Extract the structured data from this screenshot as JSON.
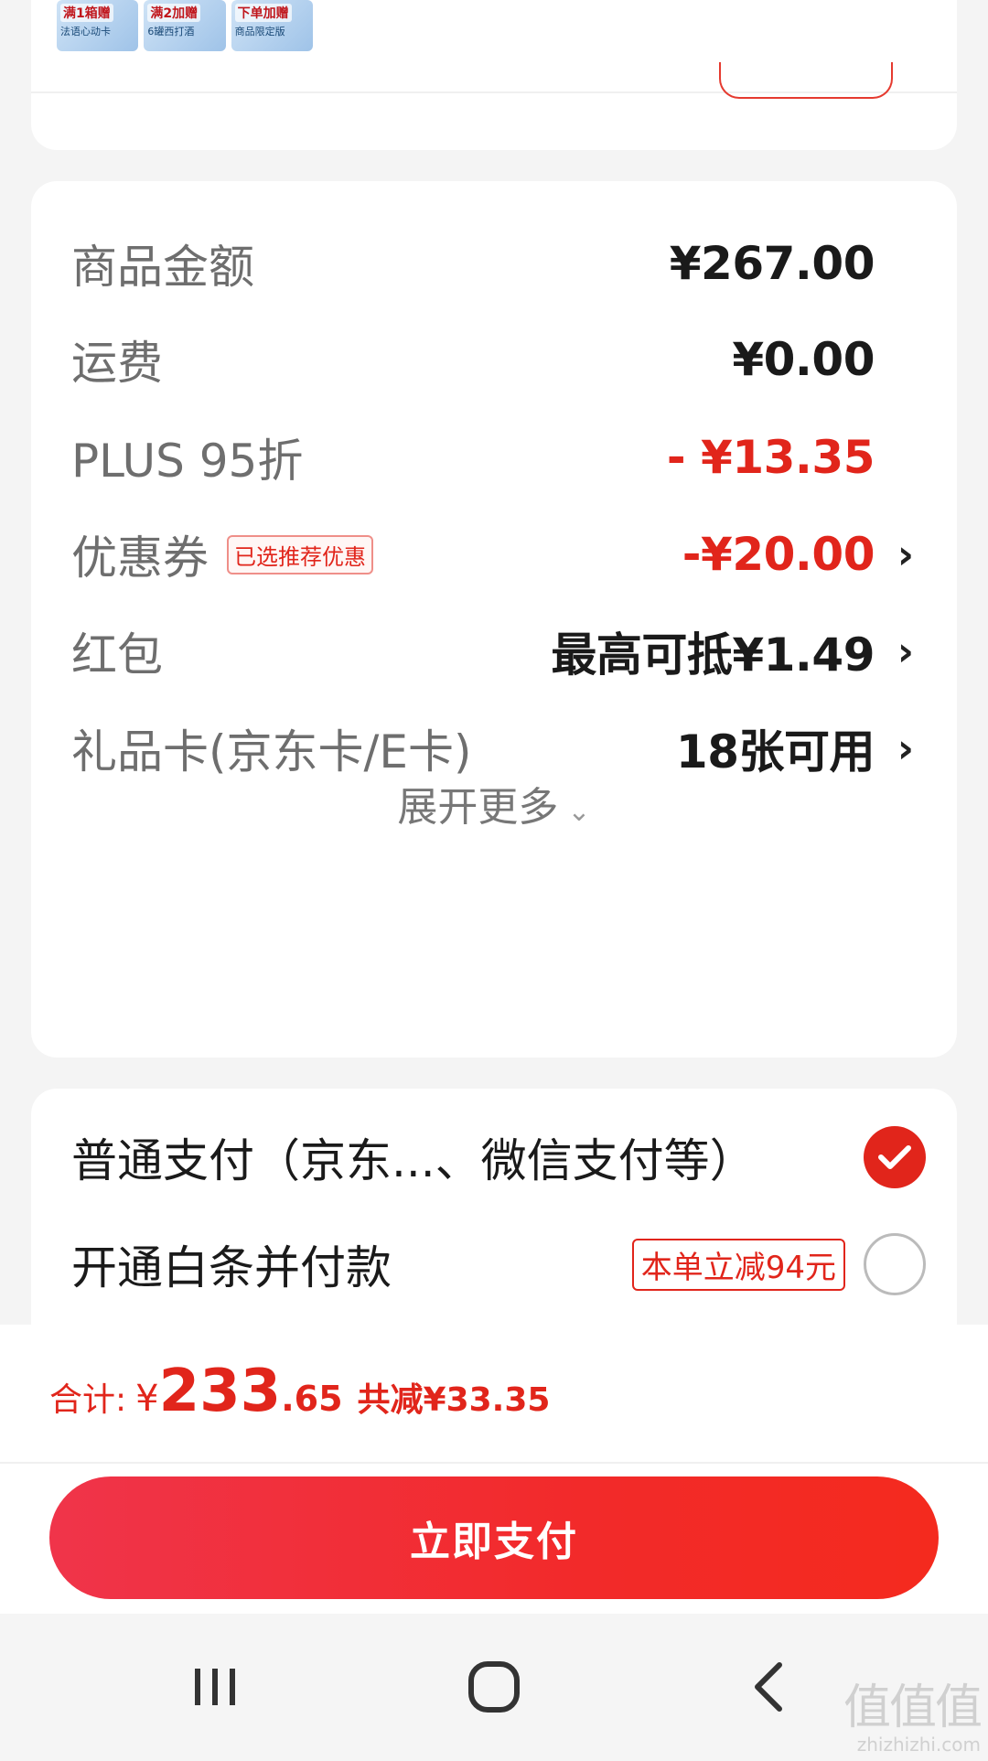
{
  "promo": {
    "items": [
      {
        "title": "满1箱赠",
        "subtitle": "法语心动卡"
      },
      {
        "title": "满2加赠",
        "subtitle": "6罐西打酒"
      },
      {
        "title": "下单加赠",
        "subtitle": "商品限定版"
      }
    ]
  },
  "summary": {
    "goods_label": "商品金额",
    "goods_value": "¥267.00",
    "shipping_label": "运费",
    "shipping_value": "¥0.00",
    "plus_label": "PLUS 95折",
    "plus_value": "- ¥13.35",
    "coupon_label": "优惠券",
    "coupon_badge": "已选推荐优惠",
    "coupon_value": "-¥20.00",
    "redpacket_label": "红包",
    "redpacket_value": "最高可抵¥1.49",
    "giftcard_label": "礼品卡(京东卡/E卡)",
    "giftcard_value": "18张可用",
    "expand_label": "展开更多"
  },
  "payment": {
    "normal_label": "普通支付（京东...、微信支付等）",
    "normal_selected": true,
    "baitiao_label": "开通白条并付款",
    "baitiao_badge": "本单立减94元",
    "baitiao_selected": false
  },
  "footer": {
    "total_label": "合计:",
    "currency": "¥",
    "total_int": "233",
    "total_dec": ".65",
    "saved_text": "共减¥33.35",
    "pay_button": "立即支付"
  },
  "watermark": {
    "logo": "值值值",
    "text": "zhizhizhi.com"
  },
  "colors": {
    "accent": "#e1251b",
    "background": "#f4f4f4"
  }
}
